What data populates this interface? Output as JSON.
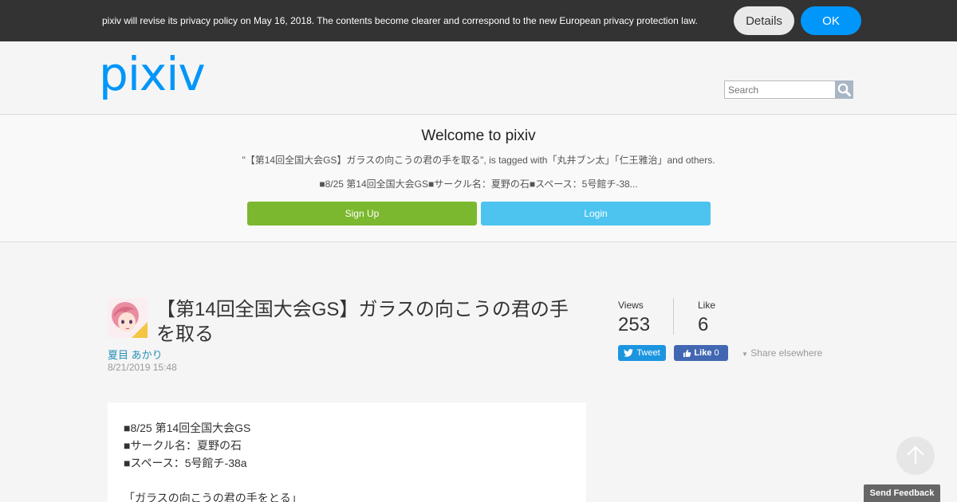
{
  "privacy_bar": {
    "text": "pixiv will revise its privacy policy on May 16, 2018. The contents become clearer and correspond to the new European privacy protection law.",
    "details_label": "Details",
    "ok_label": "OK"
  },
  "header": {
    "logo": "pixiv",
    "search_placeholder": "Search"
  },
  "welcome": {
    "title": "Welcome to pixiv",
    "tagline": "\"【第14回全国大会GS】ガラスの向こうの君の手を取る\", is tagged with「丸井ブン太」「仁王雅治」and others.",
    "excerpt": "■8/25 第14回全国大会GS■サークル名：夏野の石■スペース：5号館チ-38...",
    "signup_label": "Sign Up",
    "login_label": "Login"
  },
  "work": {
    "title": "【第14回全国大会GS】ガラスの向こうの君の手を取る",
    "author": "夏目 あかり",
    "date": "8/21/2019 15:48",
    "views_label": "Views",
    "views": "253",
    "like_label": "Like",
    "likes": "6",
    "tweet_label": "Tweet",
    "fb_like_label": "Like",
    "fb_like_count": "0",
    "share_else_label": "Share elsewhere",
    "caption_lines": [
      "■8/25 第14回全国大会GS",
      "■サークル名：夏野の石",
      "■スペース：5号館チ-38a",
      "",
      "「ガラスの向こうの君の手をとる」"
    ]
  },
  "feedback_label": "Send Feedback",
  "colors": {
    "brand": "#0096fa",
    "signup": "#7cb82f",
    "login": "#4dc4f0",
    "tweet": "#1b95e0",
    "facebook": "#4267b2"
  }
}
